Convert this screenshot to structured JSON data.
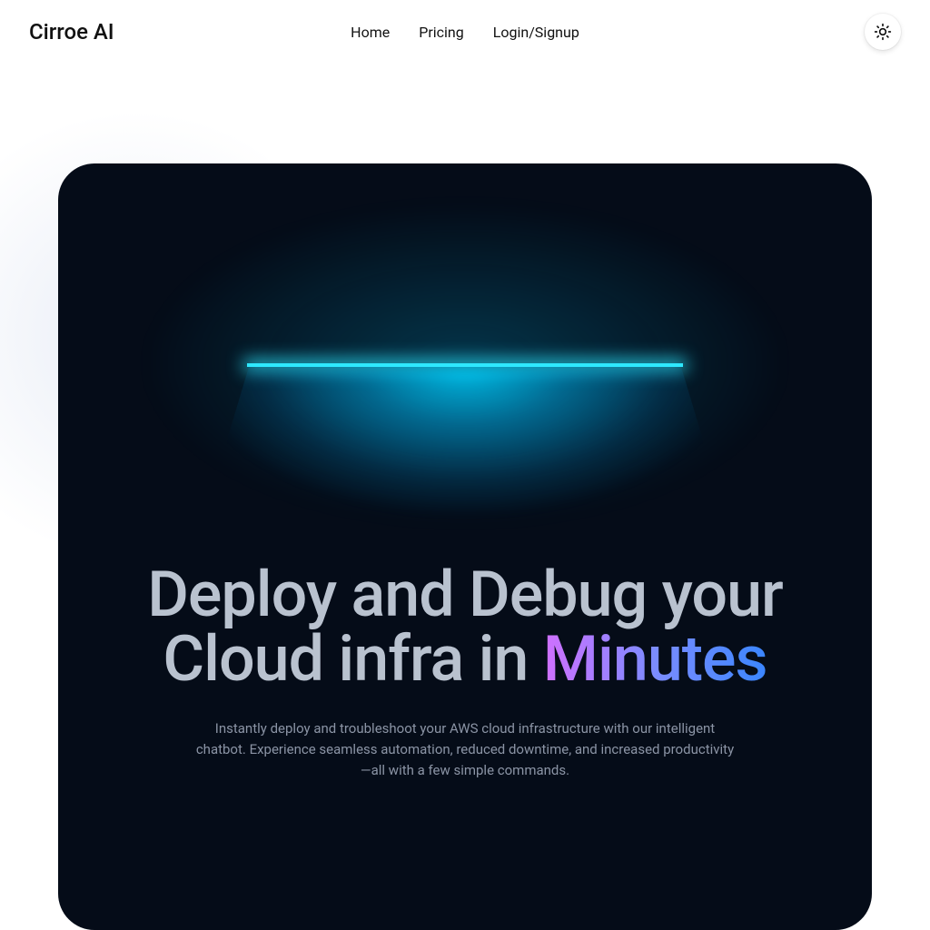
{
  "header": {
    "brand": "Cirroe AI",
    "nav": [
      "Home",
      "Pricing",
      "Login/Signup"
    ]
  },
  "hero": {
    "headline_pre": "Deploy and Debug your Cloud infra in ",
    "headline_accent": "Minutes",
    "sub": "Instantly deploy and troubleshoot your AWS cloud infrastructure with our intelligent chatbot. Experience seamless automation, reduced downtime, and increased productivity—all with a few simple commands."
  },
  "colors": {
    "accent_glow": "#2ee8ff",
    "card_bg": "#050c18"
  }
}
